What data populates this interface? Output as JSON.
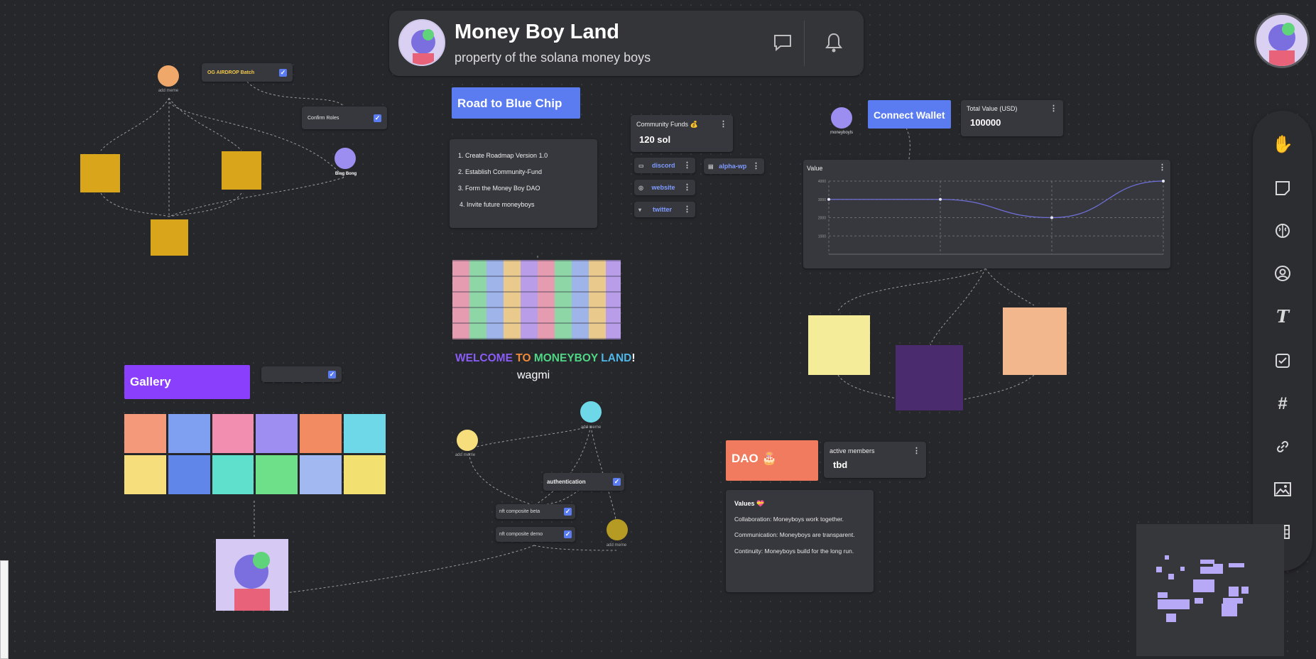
{
  "header": {
    "title": "Money Boy Land",
    "subtitle": "property of the solana money boys"
  },
  "colors": {
    "canvas": "#26272b",
    "card": "#37383d",
    "accent_blue": "#5a7cf0",
    "gallery_purple": "#8a3ffc",
    "dao_orange": "#f07b5e"
  },
  "icons": {
    "chat": "chat-bubble-icon",
    "bell": "bell-icon",
    "hand": "hand-icon",
    "note": "sticky-note-icon",
    "brain": "brain-icon",
    "user": "user-circle-icon",
    "text": "text-icon",
    "checkbox": "checkbox-icon",
    "hashtag": "hashtag-icon",
    "link": "link-icon",
    "image": "image-icon",
    "table": "table-icon"
  },
  "canvas": {
    "og_airdrop": "OG AIRDROP Batch",
    "confirm_roles": "Confirm Roles",
    "bing_bong": "Bing Bong",
    "add_meme": "add meme",
    "road_to_blue_chip": "Road to Blue Chip",
    "roadmap": [
      "1. Create Roadmap Version 1.0",
      "2. Establish Community-Fund",
      "3. Form the Money Boy DAO",
      "4. Invite future moneyboys"
    ],
    "community_funds_label": "Community Funds 💰",
    "community_funds_value": "120 sol",
    "links": [
      "discord",
      "website",
      "twitter"
    ],
    "alpha_wp": "alpha-wp",
    "welcome": {
      "w1": "WELCOME",
      "w2": "TO",
      "w3": "MONEYBOY",
      "w4": "LAND",
      "w5": "!",
      "sub": "wagmi"
    },
    "gallery": "Gallery",
    "authentication": "authentication",
    "nft_beta": "nft composite beta",
    "nft_demo": "nft composite demo",
    "moneyboy_label": "moneyboyls",
    "connect_wallet": "Connect Wallet",
    "total_value_label": "Total Value (USD)",
    "total_value": "100000",
    "dao": "DAO 🎂",
    "active_members_label": "active members",
    "active_members_value": "tbd",
    "values_title": "Values 💝",
    "values": [
      "Collaboration: Moneyboys work together.",
      "Communication: Moneyboys are transparent.",
      "Continuity: Moneyboys build for the long run."
    ]
  },
  "chart_data": {
    "type": "line",
    "title": "Value",
    "ylim": [
      0,
      4000
    ],
    "y_ticks": [
      "4000",
      "3000",
      "2000",
      "1000"
    ],
    "x": [
      0,
      1,
      2,
      3
    ],
    "series": [
      {
        "values": [
          3000,
          3000,
          2000,
          4000
        ]
      }
    ],
    "grid": true
  }
}
